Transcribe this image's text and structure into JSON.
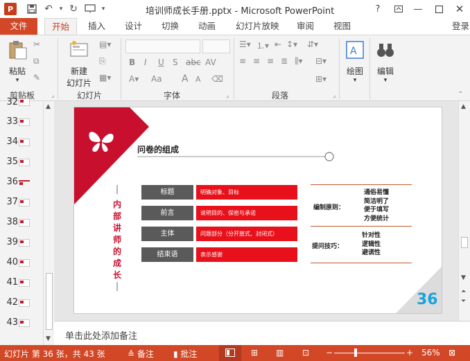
{
  "window": {
    "title": "培训师成长手册.pptx - Microsoft PowerPoint",
    "help": "?",
    "login": "登录"
  },
  "tabs": [
    {
      "label": "文件"
    },
    {
      "label": "开始"
    },
    {
      "label": "插入"
    },
    {
      "label": "设计"
    },
    {
      "label": "切换"
    },
    {
      "label": "动画"
    },
    {
      "label": "幻灯片放映"
    },
    {
      "label": "审阅"
    },
    {
      "label": "视图"
    }
  ],
  "ribbon": {
    "clipboard": {
      "label": "剪贴板",
      "paste": "粘贴"
    },
    "slides": {
      "label": "幻灯片",
      "new_slide": "新建",
      "new_slide2": "幻灯片"
    },
    "font": {
      "label": "字体",
      "bold": "B",
      "italic": "I",
      "underline": "U",
      "shadow": "S",
      "strike": "abc",
      "spacing": "AV",
      "case": "Aa",
      "grow": "A",
      "shrink": "A"
    },
    "paragraph": {
      "label": "段落"
    },
    "drawing": {
      "label": "绘图"
    },
    "editing": {
      "label": "编辑"
    }
  },
  "thumbnails": [
    {
      "num": "32"
    },
    {
      "num": "33"
    },
    {
      "num": "34"
    },
    {
      "num": "35"
    },
    {
      "num": "36"
    },
    {
      "num": "37"
    },
    {
      "num": "38"
    },
    {
      "num": "39"
    },
    {
      "num": "40"
    },
    {
      "num": "41"
    },
    {
      "num": "42"
    },
    {
      "num": "43"
    }
  ],
  "slide": {
    "heading": "问卷的组成",
    "vertical_title": [
      "内",
      "部",
      "讲",
      "师",
      "的",
      "成",
      "长"
    ],
    "rows": [
      {
        "label": "标题",
        "desc": "明确对象、目标"
      },
      {
        "label": "前言",
        "desc": "说明目的、保密与承诺"
      },
      {
        "label": "主体",
        "desc": "问题部分（分开放式、封闭式）"
      },
      {
        "label": "结束语",
        "desc": "表示感谢"
      }
    ],
    "principles_label": "编制原则：",
    "principles": [
      "通俗易懂",
      "简洁明了",
      "便于填写",
      "方便统计"
    ],
    "skills_label": "提问技巧：",
    "skills": [
      "针对性",
      "逻辑性",
      "避谎性"
    ],
    "page_number": "36"
  },
  "notes_placeholder": "单击此处添加备注",
  "status": {
    "slide_info": "幻灯片 第 36 张，共 43 张",
    "notes": "备注",
    "comments": "批注",
    "zoom_minus": "−",
    "zoom_plus": "+",
    "zoom": "56%",
    "zoom_fraction": 0.3
  },
  "colors": {
    "accent": "#d24726",
    "slide_red": "#c8102e",
    "bar_red": "#e8101a",
    "label_gray": "#5a5a5a",
    "page_number_blue": "#1aa3e0"
  }
}
